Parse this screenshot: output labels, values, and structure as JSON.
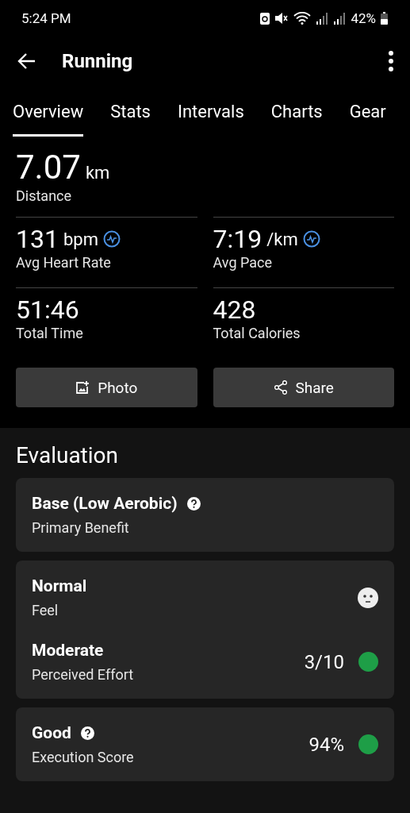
{
  "status_bar": {
    "time": "5:24 PM",
    "battery": "42%"
  },
  "app_bar": {
    "title": "Running"
  },
  "tabs": [
    {
      "label": "Overview",
      "selected": true
    },
    {
      "label": "Stats",
      "selected": false
    },
    {
      "label": "Intervals",
      "selected": false
    },
    {
      "label": "Charts",
      "selected": false
    },
    {
      "label": "Gear",
      "selected": false
    }
  ],
  "distance": {
    "value": "7.07",
    "unit": "km",
    "label": "Distance"
  },
  "stats": [
    {
      "value": "131",
      "unit": "bpm",
      "label": "Avg Heart Rate",
      "chart_link": true
    },
    {
      "value": "7:19",
      "unit": "/km",
      "label": "Avg Pace",
      "chart_link": true
    },
    {
      "value": "51:46",
      "label": "Total Time",
      "chart_link": false
    },
    {
      "value": "428",
      "label": "Total Calories",
      "chart_link": false
    }
  ],
  "buttons": [
    {
      "kind": "photo",
      "label": "Photo"
    },
    {
      "kind": "share",
      "label": "Share"
    }
  ],
  "evaluation": {
    "title": "Evaluation",
    "cards": [
      {
        "rows": [
          {
            "title": "Base (Low Aerobic)",
            "subtitle": "Primary Benefit",
            "help": true
          }
        ]
      },
      {
        "rows": [
          {
            "title": "Normal",
            "subtitle": "Feel",
            "help": false,
            "kind": "face"
          },
          {
            "title": "Moderate",
            "subtitle": "Perceived Effort",
            "help": false,
            "kind": "score",
            "value": "3/10",
            "color": "#1e9e47"
          }
        ]
      },
      {
        "rows": [
          {
            "title": "Good",
            "subtitle": "Execution Score",
            "help": true,
            "kind": "score",
            "value": "94%",
            "color": "#1e9e47"
          }
        ]
      }
    ]
  }
}
